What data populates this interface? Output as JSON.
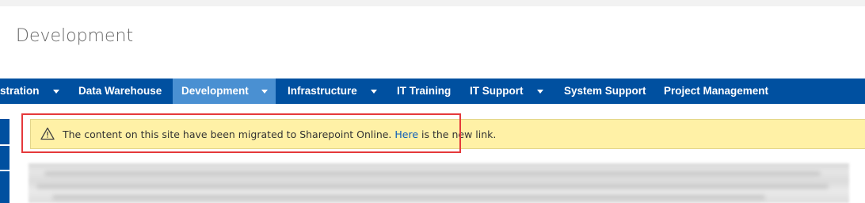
{
  "site": {
    "title": "Development"
  },
  "nav": {
    "items": [
      {
        "label": "stration",
        "has_dropdown": true
      },
      {
        "label": "Data Warehouse",
        "has_dropdown": false
      },
      {
        "label": "Development",
        "has_dropdown": true,
        "active": true
      },
      {
        "label": "Infrastructure",
        "has_dropdown": true
      },
      {
        "label": "IT Training",
        "has_dropdown": false
      },
      {
        "label": "IT Support",
        "has_dropdown": true
      },
      {
        "label": "System Support",
        "has_dropdown": false
      },
      {
        "label": "Project Management",
        "has_dropdown": false
      }
    ]
  },
  "banner": {
    "icon": "warning-triangle-icon",
    "text_before": "The content on this site have been migrated to Sharepoint Online. ",
    "link_text": "Here",
    "text_after": " is the new link."
  },
  "colors": {
    "nav_bg": "#0050a0",
    "nav_active": "#4a90d2",
    "banner_bg": "#fff1a6",
    "highlight": "#e5393b",
    "link": "#0b5cb8"
  }
}
